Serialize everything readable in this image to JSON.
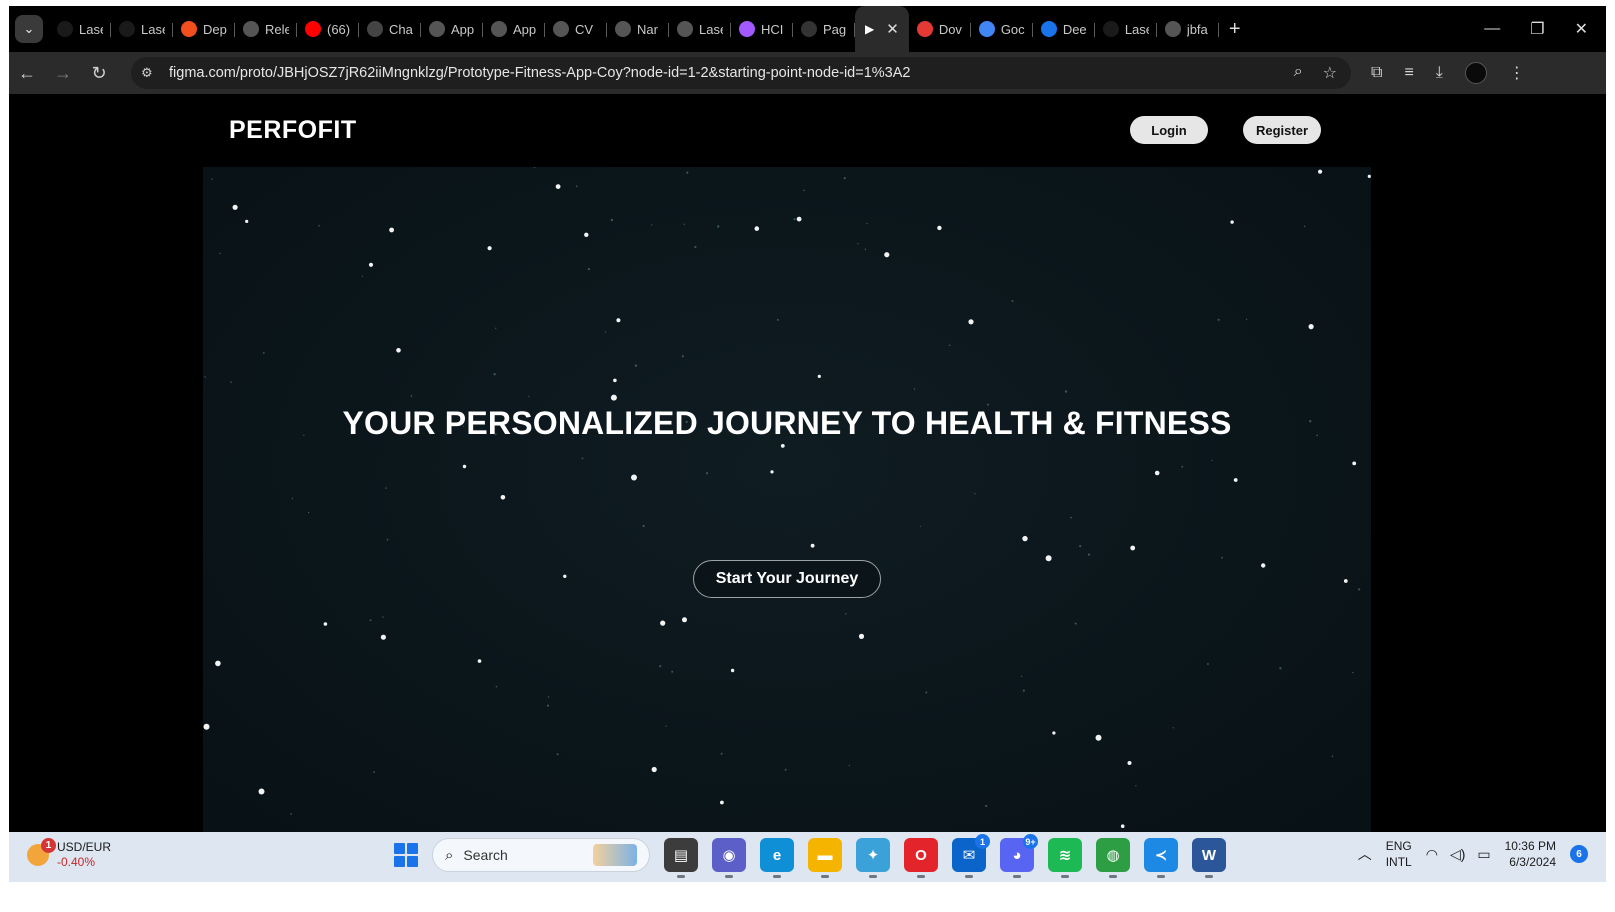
{
  "browser": {
    "tabs": [
      {
        "label": "Lase",
        "icon": "github-icon",
        "color": "#1a1a1a"
      },
      {
        "label": "Lase",
        "icon": "github-icon",
        "color": "#1a1a1a"
      },
      {
        "label": "Dep",
        "icon": "figma-icon",
        "color": "#f24e1e"
      },
      {
        "label": "Rele",
        "icon": "globe-icon",
        "color": "#555555"
      },
      {
        "label": "(66)",
        "icon": "youtube-icon",
        "color": "#ff0000"
      },
      {
        "label": "Cha",
        "icon": "chatgpt-icon",
        "color": "#444444"
      },
      {
        "label": "App",
        "icon": "app-icon",
        "color": "#555555"
      },
      {
        "label": "App",
        "icon": "app-icon",
        "color": "#555555"
      },
      {
        "label": "CV",
        "icon": "globe-icon",
        "color": "#555555"
      },
      {
        "label": "Nar",
        "icon": "globe-icon",
        "color": "#555555"
      },
      {
        "label": "Lase",
        "icon": "globe-icon",
        "color": "#555555"
      },
      {
        "label": "HCI",
        "icon": "figma-icon",
        "color": "#a259ff"
      },
      {
        "label": "Pag",
        "icon": "play-icon",
        "color": "#333333"
      }
    ],
    "tabs_after": [
      {
        "label": "Dov",
        "icon": "heart-icon",
        "color": "#e53935"
      },
      {
        "label": "Goc",
        "icon": "translate-icon",
        "color": "#4285f4"
      },
      {
        "label": "Dee",
        "icon": "deepl-icon",
        "color": "#1a73e8"
      },
      {
        "label": "Lase",
        "icon": "github-icon",
        "color": "#1a1a1a"
      },
      {
        "label": "jbfa",
        "icon": "globe-icon",
        "color": "#555555"
      }
    ],
    "url": "figma.com/proto/JBHjOSZ7jR62iiMngnklzg/Prototype-Fitness-App-Coy?node-id=1-2&starting-point-node-id=1%3A2"
  },
  "site": {
    "brand": "PERFOFIT",
    "login_label": "Login",
    "register_label": "Register",
    "hero_title": "YOUR PERSONALIZED JOURNEY TO HEALTH & FITNESS",
    "cta_label": "Start Your Journey"
  },
  "taskbar": {
    "widget": {
      "title": "USD/EUR",
      "change": "-0.40%",
      "badge": "1"
    },
    "search_label": "Search",
    "apps": [
      {
        "name": "file-manager-icon",
        "color": "#3c3c3c",
        "glyph": "▤"
      },
      {
        "name": "teams-icon",
        "color": "#5b5fc7",
        "glyph": "◉"
      },
      {
        "name": "edge-icon",
        "color": "#0f8fd6",
        "glyph": "e"
      },
      {
        "name": "folder-icon",
        "color": "#f4b400",
        "glyph": "▬"
      },
      {
        "name": "browser-icon",
        "color": "#3ba1d9",
        "glyph": "✦"
      },
      {
        "name": "opera-icon",
        "color": "#e3242b",
        "glyph": "O"
      },
      {
        "name": "mail-icon",
        "color": "#0a64c9",
        "glyph": "✉",
        "badge": "1"
      },
      {
        "name": "discord-icon",
        "color": "#5865f2",
        "glyph": "◕",
        "badge": "9+"
      },
      {
        "name": "spotify-icon",
        "color": "#1db954",
        "glyph": "≋"
      },
      {
        "name": "chrome-icon",
        "color": "#2e9e44",
        "glyph": "◍"
      },
      {
        "name": "vscode-icon",
        "color": "#1e88e5",
        "glyph": "≺"
      },
      {
        "name": "word-icon",
        "color": "#2b579a",
        "glyph": "W"
      }
    ],
    "lang_top": "ENG",
    "lang_bottom": "INTL",
    "time": "10:36 PM",
    "date": "6/3/2024",
    "notifications": "6"
  }
}
